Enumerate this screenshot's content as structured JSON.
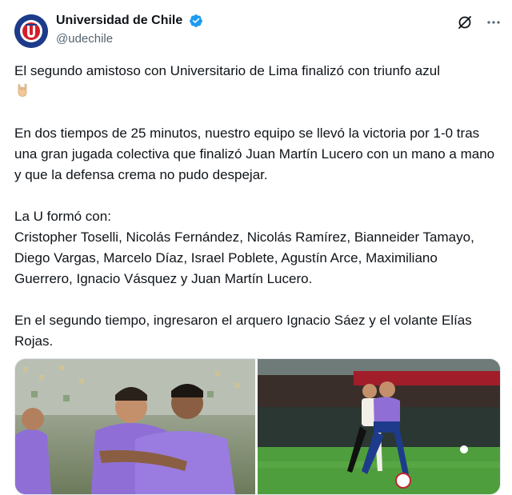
{
  "tweet": {
    "author": {
      "display_name": "Universidad de Chile",
      "handle": "@udechile",
      "verified": true,
      "avatar_icon": "udechile-crest-icon"
    },
    "actions": {
      "grok_icon": "grok-icon",
      "more_icon": "more-dots-icon"
    },
    "paragraphs": [
      "El segundo amistoso con Universitario de Lima finalizó con triunfo azul",
      "En dos tiempos de 25 minutos, nuestro equipo se llevó la victoria por 1-0 tras una gran jugada colectiva que finalizó Juan Martín Lucero con un mano a mano y que la defensa crema no pudo despejar.",
      "La U formó con:",
      "Cristopher Toselli, Nicolás Fernández, Nicolás Ramírez, Bianneider Tamayo, Diego Vargas, Marcelo Díaz, Israel Poblete, Agustín Arce, Maximiliano Guerrero, Ignacio Vásquez y Juan Martín Lucero.",
      "En el segundo tiempo, ingresaron el arquero Ignacio Sáez y el volante Elías Rojas."
    ],
    "emoji": "sign-of-the-horns-emoji",
    "media": [
      {
        "name": "team-celebration-photo"
      },
      {
        "name": "player-dribbling-photo"
      }
    ],
    "colors": {
      "verified": "#1d9bf0",
      "text": "#0f1419",
      "secondary": "#536471",
      "jersey": "#8f6fd6"
    }
  }
}
